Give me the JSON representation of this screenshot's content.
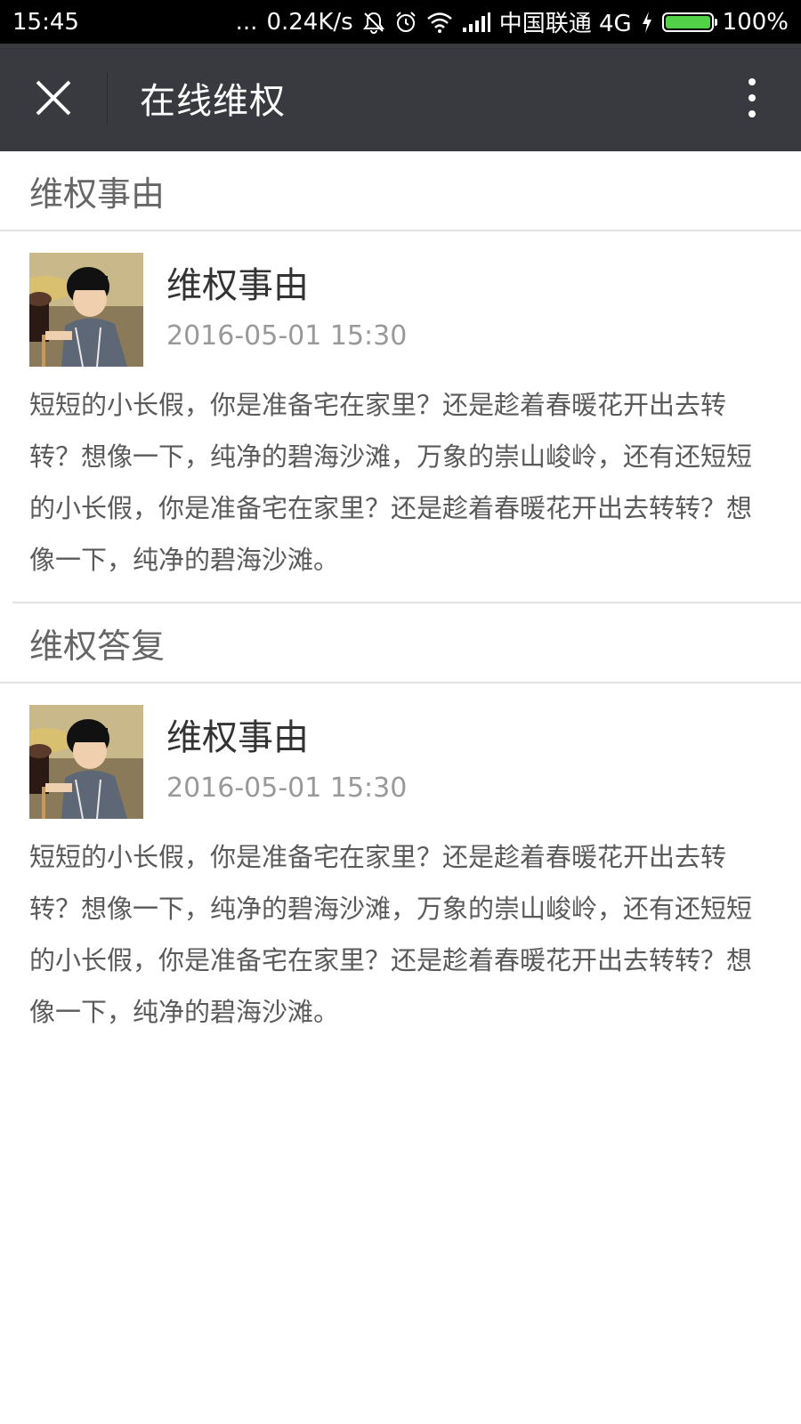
{
  "status_bar": {
    "time": "15:45",
    "dots": "...",
    "net_speed": "0.24K/s",
    "carrier": "中国联通 4G",
    "battery": "100%",
    "battery_level": 1.0,
    "battery_color": "#52d148"
  },
  "title_bar": {
    "title": "在线维权",
    "close_icon": "close-icon",
    "more_icon": "more-vertical-icon"
  },
  "sections": [
    {
      "header": "维权事由",
      "entry": {
        "title": "维权事由",
        "time": "2016-05-01 15:30",
        "body": "短短的小长假，你是准备宅在家里？还是趁着春暖花开出去转转？想像一下，纯净的碧海沙滩，万象的崇山峻岭，还有还短短的小长假，你是准备宅在家里？还是趁着春暖花开出去转转？想像一下，纯净的碧海沙滩。"
      }
    },
    {
      "header": "维权答复",
      "entry": {
        "title": "维权事由",
        "time": "2016-05-01 15:30",
        "body": "短短的小长假，你是准备宅在家里？还是趁着春暖花开出去转转？想像一下，纯净的碧海沙滩，万象的崇山峻岭，还有还短短的小长假，你是准备宅在家里？还是趁着春暖花开出去转转？想像一下，纯净的碧海沙滩。"
      }
    }
  ],
  "colors": {
    "title_bar_bg": "#393a3f",
    "status_bar_bg": "#000000",
    "section_header_text": "#666666",
    "time_text": "#999999"
  }
}
